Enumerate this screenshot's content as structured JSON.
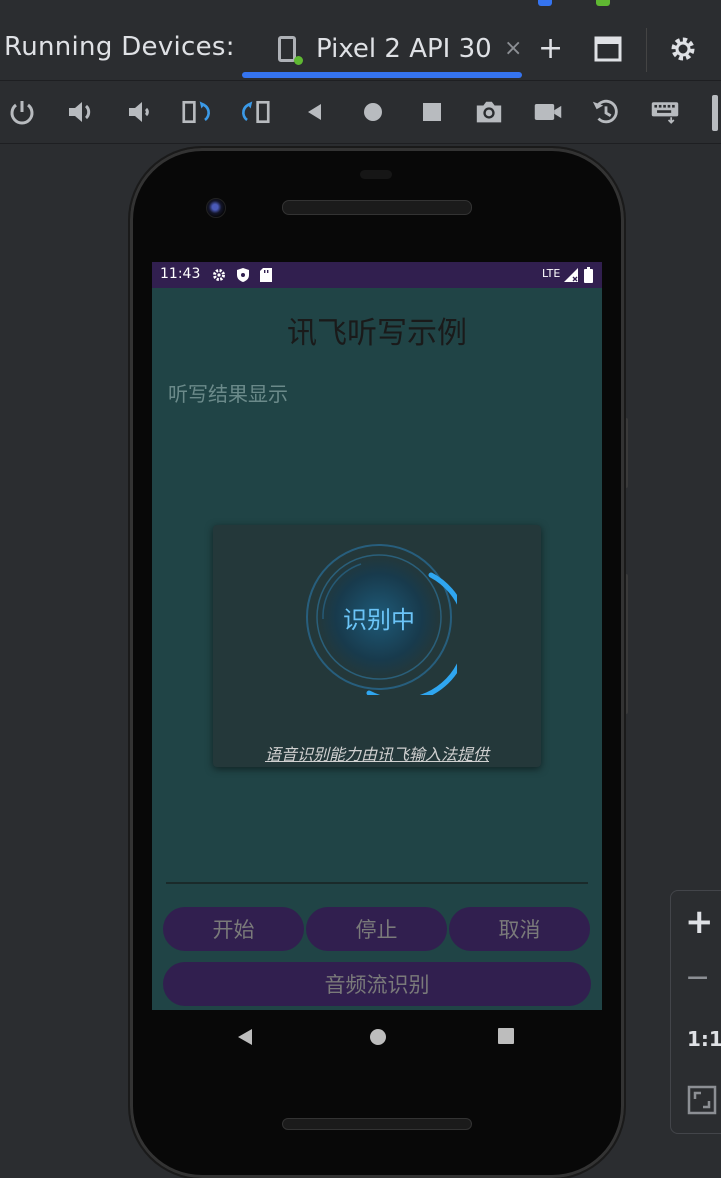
{
  "window": {
    "running_devices_label": "Running Devices:",
    "device_tab_label": "Pixel 2 API 30",
    "tab_close": "×",
    "add_tab": "+",
    "accent_color": "#3574f0"
  },
  "toolbar": {
    "icons": [
      "power-icon",
      "volume-up-icon",
      "volume-down-icon",
      "rotate-left-icon",
      "rotate-right-icon",
      "back-icon",
      "home-icon",
      "overview-icon",
      "screenshot-icon",
      "screen-record-icon",
      "snapshot-icon",
      "keyboard-icon"
    ]
  },
  "device": {
    "status_bar": {
      "time": "11:43",
      "network": "LTE"
    },
    "app": {
      "title": "讯飞听写示例",
      "result_placeholder": "听写结果显示",
      "dialog": {
        "status": "识别中",
        "credit": "语音识别能力由讯飞输入法提供"
      },
      "buttons": {
        "start": "开始",
        "stop": "停止",
        "cancel": "取消",
        "audio_stream": "音频流识别"
      },
      "colors": {
        "background": "#204446",
        "primary": "#311f4f",
        "ring": "#2fa6f0"
      }
    }
  },
  "zoom": {
    "zoom_in": "+",
    "zoom_out": "−",
    "actual_size": "1:1"
  }
}
